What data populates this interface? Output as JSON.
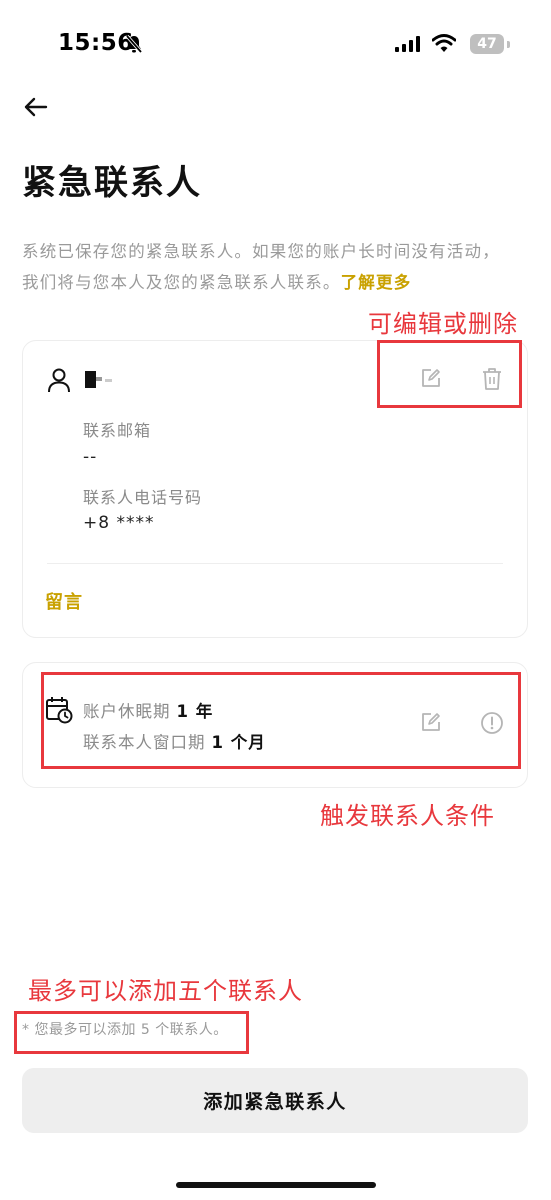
{
  "status_bar": {
    "time": "15:56",
    "battery": "47"
  },
  "page": {
    "title": "紧急联系人",
    "description": "系统已保存您的紧急联系人。如果您的账户长时间没有活动，我们将与您本人及您的紧急联系人联系。",
    "learn_more": "了解更多"
  },
  "contact_card": {
    "email_label": "联系邮箱",
    "email_value": "--",
    "phone_label": "联系人电话号码",
    "phone_value": "+8  ****",
    "message_link": "留言"
  },
  "trigger_card": {
    "dormancy_label": "账户休眠期",
    "dormancy_value": "1 年",
    "window_label": "联系本人窗口期",
    "window_value": "1 个月"
  },
  "footer": {
    "note": "* 您最多可以添加 5 个联系人。",
    "add_button": "添加紧急联系人"
  },
  "annotations": {
    "edit_delete": "可编辑或删除",
    "trigger": "触发联系人条件",
    "max_contacts": "最多可以添加五个联系人"
  },
  "icons": [
    "bell-off-icon",
    "signal-icon",
    "wifi-icon",
    "back-arrow-icon",
    "user-icon",
    "edit-icon",
    "trash-icon",
    "calendar-clock-icon",
    "info-icon"
  ],
  "colors": {
    "accent": "#c9a100",
    "annotation": "#e8383d",
    "muted_text": "#9a9a9a",
    "button_bg": "#eeeeee"
  }
}
